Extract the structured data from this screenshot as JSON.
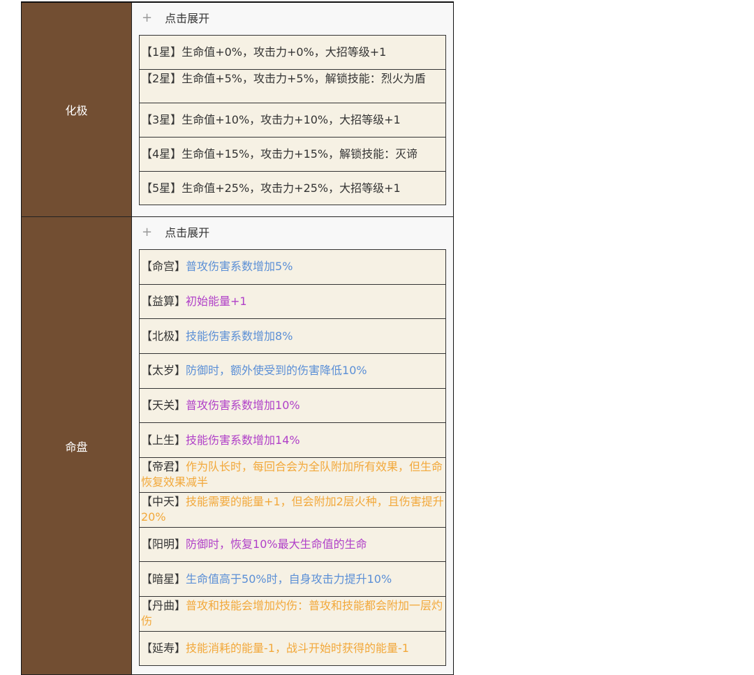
{
  "colors": {
    "blue": "#5b8fd6",
    "purple": "#b040c8",
    "orange": "#f2a83a",
    "label_bg": "#724e32"
  },
  "sections": [
    {
      "label": "化极",
      "expand": "点击展开",
      "items": [
        {
          "tag": "【1星】",
          "text": "生命值+0%，攻击力+0%，大招等级+1",
          "color": ""
        },
        {
          "tag": "【2星】",
          "text": "生命值+5%，攻击力+5%，解锁技能：烈火为盾",
          "color": "",
          "wrap": true
        },
        {
          "tag": "【3星】",
          "text": "生命值+10%，攻击力+10%，大招等级+1",
          "color": ""
        },
        {
          "tag": "【4星】",
          "text": "生命值+15%，攻击力+15%，解锁技能：灭谛",
          "color": ""
        },
        {
          "tag": "【5星】",
          "text": "生命值+25%，攻击力+25%，大招等级+1",
          "color": ""
        }
      ]
    },
    {
      "label": "命盘",
      "expand": "点击展开",
      "items": [
        {
          "tag": "【命宫】",
          "text": "普攻伤害系数增加5%",
          "color": "blue"
        },
        {
          "tag": "【益算】",
          "text": "初始能量+1",
          "color": "purple"
        },
        {
          "tag": "【北极】",
          "text": "技能伤害系数增加8%",
          "color": "blue"
        },
        {
          "tag": "【太岁】",
          "text": "防御时，额外使受到的伤害降低10%",
          "color": "blue"
        },
        {
          "tag": "【天关】",
          "text": "普攻伤害系数增加10%",
          "color": "purple"
        },
        {
          "tag": "【上生】",
          "text": "技能伤害系数增加14%",
          "color": "purple"
        },
        {
          "tag": "【帝君】",
          "text": "作为队长时，每回合会为全队附加所有效果，但生命恢复效果减半",
          "color": "orange",
          "wrap": true
        },
        {
          "tag": "【中天】",
          "text": "技能需要的能量+1，但会附加2层火种，且伤害提升20%",
          "color": "orange",
          "wrap": true
        },
        {
          "tag": "【阳明】",
          "text": "防御时，恢复10%最大生命值的生命",
          "color": "purple"
        },
        {
          "tag": "【暗星】",
          "text": "生命值高于50%时，自身攻击力提升10%",
          "color": "blue"
        },
        {
          "tag": "【丹曲】",
          "text": "普攻和技能会增加灼伤：普攻和技能都会附加一层灼伤",
          "color": "orange",
          "wrap": true
        },
        {
          "tag": "【延寿】",
          "text": "技能消耗的能量-1，战斗开始时获得的能量-1",
          "color": "orange"
        }
      ]
    }
  ]
}
